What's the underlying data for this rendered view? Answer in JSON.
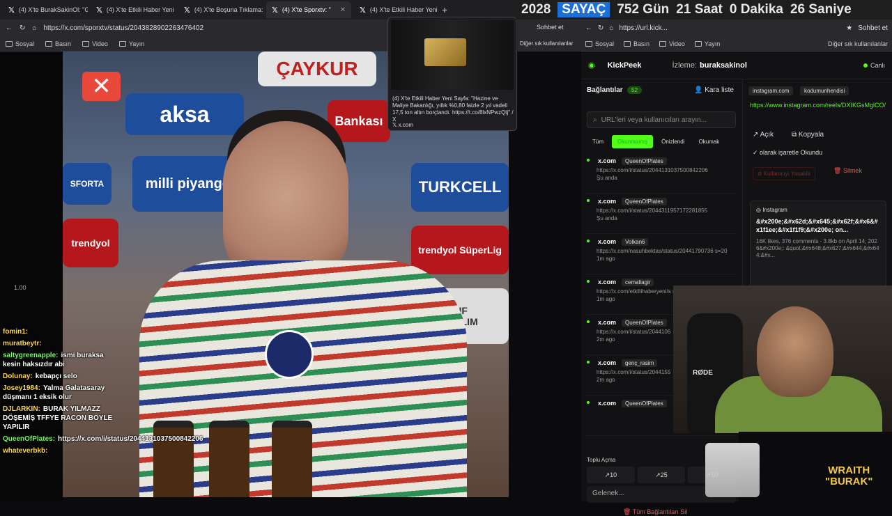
{
  "left_browser": {
    "tabs": [
      {
        "label": "(4) X'te BurakSakinOl: \"G",
        "active": false
      },
      {
        "label": "(4) X'te Etkili Haber Yeni",
        "active": false
      },
      {
        "label": "(4) X'te Boşuna Tıklama:",
        "active": false
      },
      {
        "label": "(4) X'te Sporxtv: \"",
        "active": true
      },
      {
        "label": "(4) X'te Etkili Haber Yeni",
        "active": false
      }
    ],
    "url": "https://x.com/sporxtv/status/2043828902263476402",
    "bookmarks": [
      "Sosyal",
      "Basın",
      "Video",
      "Yayın"
    ]
  },
  "preview": {
    "title": "(4) X'te Etkili Haber Yeni Sayfa: \"Hazine ve Maliye Bakanlığı, yıllık %0,80 faizle 2 yıl vadeli 17,5 ton altın borçlandı. https://t.co/8lxNPwzQtj\" / X",
    "host": "x.com"
  },
  "timer": {
    "year": "2028",
    "label": "SAYAÇ",
    "days": "752 Gün",
    "hours": "21 Saat",
    "minutes": "0 Dakika",
    "seconds": "26 Saniye"
  },
  "middle_bar": {
    "chat_label": "Sohbet et",
    "other_bookmarks": "Diğer sık kullanılanlar"
  },
  "right_browser": {
    "url": "https://url.kick...",
    "chat_label": "Sohbet et",
    "bookmarks": [
      "Sosyal",
      "Basın",
      "Video",
      "Yayın"
    ],
    "other_bookmarks": "Diğer sık kullanılanlar"
  },
  "kickpeek": {
    "brand": "KickPeek",
    "watching_label": "İzleme:",
    "watching_user": "buraksakinol",
    "status": "Canlı",
    "connections_title": "Bağlantılar",
    "connections_count": "52",
    "blacklist": "Kara liste",
    "search_placeholder": "URL'leri veya kullanıcıları arayın...",
    "filters": [
      "Tüm",
      "Okunmamış",
      "Önizlendi",
      "Okumak"
    ],
    "rows": [
      {
        "host": "x.com",
        "user": "QueenOfPlates",
        "url": "https://x.com/i/status/2044131037500842206",
        "time": "Şu anda"
      },
      {
        "host": "x.com",
        "user": "QueenOfPlates",
        "url": "https://x.com/i/status/2044311957172281855",
        "time": "Şu anda"
      },
      {
        "host": "x.com",
        "user": "Volkan6",
        "url": "https://x.com/nasuhbektas/status/20441790736 s=20",
        "time": "1m ago"
      },
      {
        "host": "x.com",
        "user": "cemaliagir",
        "url": "https://x.com/etkiliihaberyeni/s s=46",
        "time": "1m ago"
      },
      {
        "host": "x.com",
        "user": "QueenOfPlates",
        "url": "https://x.com/i/status/2044106",
        "time": "2m ago"
      },
      {
        "host": "x.com",
        "user": "genç_rasim",
        "url": "https://x.com/i/status/2044155",
        "time": "2m ago"
      },
      {
        "host": "x.com",
        "user": "QueenOfPlates",
        "url": "",
        "time": ""
      }
    ],
    "bulk_label": "Toplu Açma",
    "bulk_buttons": [
      "10",
      "25",
      "50"
    ],
    "incoming_placeholder": "Gelenek...",
    "delete_all": "Tüm Bağlantıları Sil",
    "detail": {
      "chip1": "instagram.com",
      "chip2": "kodumunhendisi",
      "url": "https://www.instagram.com/reels/DXIKGsMglCO/",
      "open": "Açık",
      "copy": "Kopyala",
      "mark_read": "olarak işaretle Okundu",
      "block_user": "Kullanıcıyı Yasakla",
      "delete": "Silmek",
      "card_title": "Instagram",
      "card_main": "&#x200e;&#x62d;&#x645;&#x62f;&#x6&#x1f1ee;&#x1f1f9;&#x200e; on...",
      "card_meta": "16K likes, 376 comments - 3.8kb on April 14, 2026&#x200e;: &quot;&#x648;&#x627;&#x644;&#x644;&#x..."
    }
  },
  "chat": [
    {
      "user": "fomin1:",
      "msg": "",
      "color": "#ffd84a"
    },
    {
      "user": "muratbeytr:",
      "msg": "",
      "color": "#ffd84a"
    },
    {
      "user": "saltygreenapple:",
      "msg": "ismi buraksa kesin haksızdır abi",
      "color": "#7cf26b"
    },
    {
      "user": "Dolunay:",
      "msg": "kebapçı selo",
      "color": "#ffd84a"
    },
    {
      "user": "Josey1984:",
      "msg": "Yalma Galatasaray düşmanı 1 eksik olur",
      "color": "#ffd84a"
    },
    {
      "user": "DJLARKIN:",
      "msg": "BURAK YILMAZZ DÖŞEMİŞ TFFYE RACON BÖYLE YAPILIR",
      "color": "#ffd84a"
    },
    {
      "user": "QueenOfPlates:",
      "msg": "https://x.com/i/status/2044131037500842206",
      "color": "#7cf26b"
    },
    {
      "user": "whateverbkb:",
      "msg": "",
      "color": "#ffd84a"
    }
  ],
  "zoom": "1.00",
  "video_sponsors": [
    "ÇAYKUR",
    "aksa",
    "milli piyango",
    "TURKCELL",
    "trendyol",
    "trendyol SüperLig",
    "VAKIF KATILIM",
    "Bankası",
    "SFORTA"
  ],
  "webcam_mic": "RØDE",
  "brand": {
    "line1": "WRAITH",
    "line2": "\"BURAK\""
  },
  "colors": {
    "accent": "#53fc18",
    "timer_highlight": "#1d6fd8",
    "danger": "#e05a5a"
  }
}
